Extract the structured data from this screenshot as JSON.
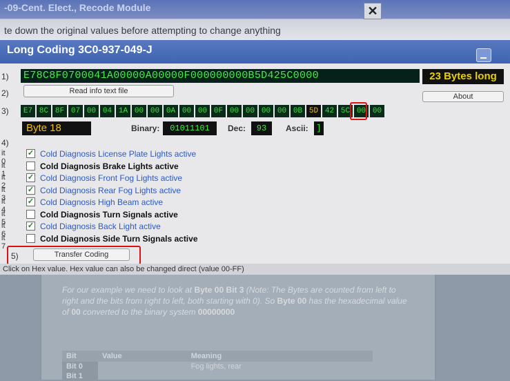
{
  "background": {
    "title": "-09-Cent. Elect., Recode Module",
    "note": "te down the original values before attempting to change anything",
    "close_glyph": "✕"
  },
  "window": {
    "title": "Long Coding 3C0-937-049-J",
    "row_labels": [
      "1)",
      "2)",
      "3)",
      "4)",
      "5)"
    ],
    "coding_value": "E78C8F0700041A00000A00000F000000000B5D425C0000",
    "bytes_long": "23 Bytes long",
    "read_info_button": "Read info text file",
    "about_button": "About",
    "bytes": [
      "E7",
      "8C",
      "8F",
      "07",
      "00",
      "04",
      "1A",
      "00",
      "00",
      "0A",
      "00",
      "00",
      "0F",
      "00",
      "00",
      "00",
      "00",
      "0B",
      "5D",
      "42",
      "5C",
      "00",
      "00"
    ],
    "selected_index": 18,
    "byte_label": "Byte 18",
    "binary_label": "Binary:",
    "binary_value": "01011101",
    "dec_label": "Dec:",
    "dec_value": "93",
    "ascii_label": "Ascii:",
    "ascii_value": "]",
    "bits": [
      {
        "tag": "it 0",
        "checked": true,
        "label": "Cold Diagnosis License Plate Lights active"
      },
      {
        "tag": "it 1",
        "checked": false,
        "label": "Cold Diagnosis Brake Lights active"
      },
      {
        "tag": "it 2",
        "checked": true,
        "label": "Cold Diagnosis Front Fog Lights active"
      },
      {
        "tag": "it 3",
        "checked": true,
        "label": "Cold Diagnosis Rear Fog Lights active"
      },
      {
        "tag": "it 4",
        "checked": true,
        "label": "Cold Diagnosis High Beam active"
      },
      {
        "tag": "it 5",
        "checked": false,
        "label": "Cold Diagnosis Turn Signals active"
      },
      {
        "tag": "it 6",
        "checked": true,
        "label": "Cold Diagnosis Back Light active"
      },
      {
        "tag": "it 7",
        "checked": false,
        "label": "Cold Diagnosis Side Turn Signals active"
      }
    ],
    "transfer_button": "Transfer Coding",
    "status": "Click on Hex value. Hex value can also be changed direct (value 00-FF)"
  },
  "paper": {
    "p1": "For our example we need to look at ",
    "p1b": "Byte 00 Bit 3",
    "p2": " (Note: The Bytes are counted from left to right and the bits from right to left, both starting with 0). So ",
    "p2b": "Byte 00",
    "p3": " has the hexadecimal value of ",
    "p3b": "00",
    "p4": " converted to the binary system ",
    "p4b": "00000000",
    "table_headers": [
      "Bit",
      "Value",
      "Meaning"
    ],
    "rows": [
      {
        "bit": "Bit 0",
        "value": "",
        "meaning": "Fog lights, rear"
      },
      {
        "bit": "Bit 1",
        "value": "",
        "meaning": ""
      }
    ]
  }
}
